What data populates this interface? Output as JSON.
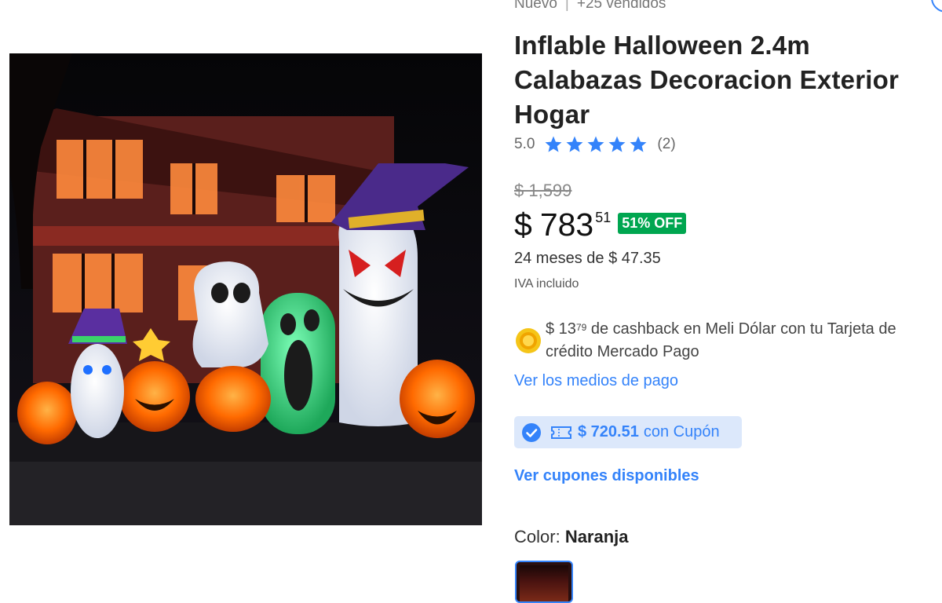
{
  "condition": {
    "status": "Nuevo",
    "separator": "|",
    "sold": "+25 vendidos"
  },
  "title": "Inflable Halloween 2.4m Calabazas Decoracion Exterior Hogar",
  "rating": {
    "score": "5.0",
    "stars": 5,
    "count": "(2)",
    "star_color": "#3483fa"
  },
  "price": {
    "original": "$ 1,599",
    "symbol": "$",
    "amount": "783",
    "cents": "51",
    "discount": "51% OFF",
    "discount_color": "#00a650",
    "installments": "24 meses de $ 47.35",
    "tax_note": "IVA incluido"
  },
  "cashback": {
    "prefix": "$ 13",
    "cents": "79",
    "line1_rest": "de cashback en Meli Dólar con tu Tarjeta de",
    "line2": "crédito Mercado Pago",
    "icon": "meli-dolar-coin-icon"
  },
  "links": {
    "payment_methods": "Ver los medios de pago",
    "coupons": "Ver cupones disponibles",
    "link_color": "#3483fa"
  },
  "coupon": {
    "amount": "$ 720.51",
    "label": "con Cupón",
    "icon": "coupon-ticket-icon"
  },
  "variant": {
    "label": "Color:",
    "value": "Naranja"
  },
  "image": {
    "alt_subject": "halloween inflatables"
  }
}
